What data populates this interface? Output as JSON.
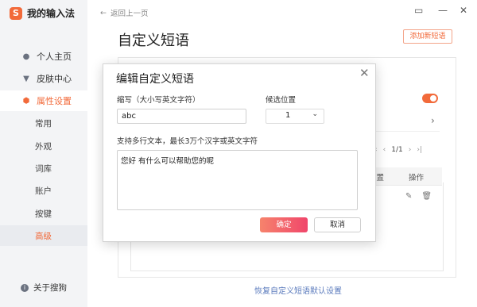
{
  "app": {
    "title": "我的输入法",
    "logo_char": "S"
  },
  "sidebar": {
    "items": [
      {
        "label": "个人主页",
        "icon": "person-icon"
      },
      {
        "label": "皮肤中心",
        "icon": "shirt-icon"
      },
      {
        "label": "属性设置",
        "icon": "gear-icon",
        "active": true
      }
    ],
    "subitems": [
      "常用",
      "外观",
      "词库",
      "账户",
      "按键",
      "高级"
    ],
    "selected_subitem": "高级",
    "about": "关于搜狗"
  },
  "header": {
    "back_label": "返回上一页",
    "page_title": "自定义短语",
    "add_button": "添加新短语"
  },
  "table": {
    "headers": [
      "位置",
      "操作"
    ],
    "page_info": "1/1"
  },
  "footer": {
    "restore_link": "恢复自定义短语默认设置"
  },
  "dialog": {
    "title": "编辑自定义短语",
    "abbr_label": "缩写（大小写英文字符）",
    "abbr_value": "abc",
    "position_label": "候选位置",
    "position_value": "1",
    "content_label": "支持多行文本，最长3万个汉字或英文字符",
    "content_value": "您好 有什么可以帮助您的呢",
    "ok_label": "确定",
    "cancel_label": "取消"
  },
  "colors": {
    "accent": "#f26a3a",
    "link": "#5b7bbd",
    "ok_gradient_start": "#f6836c",
    "ok_gradient_end": "#f0466b"
  }
}
